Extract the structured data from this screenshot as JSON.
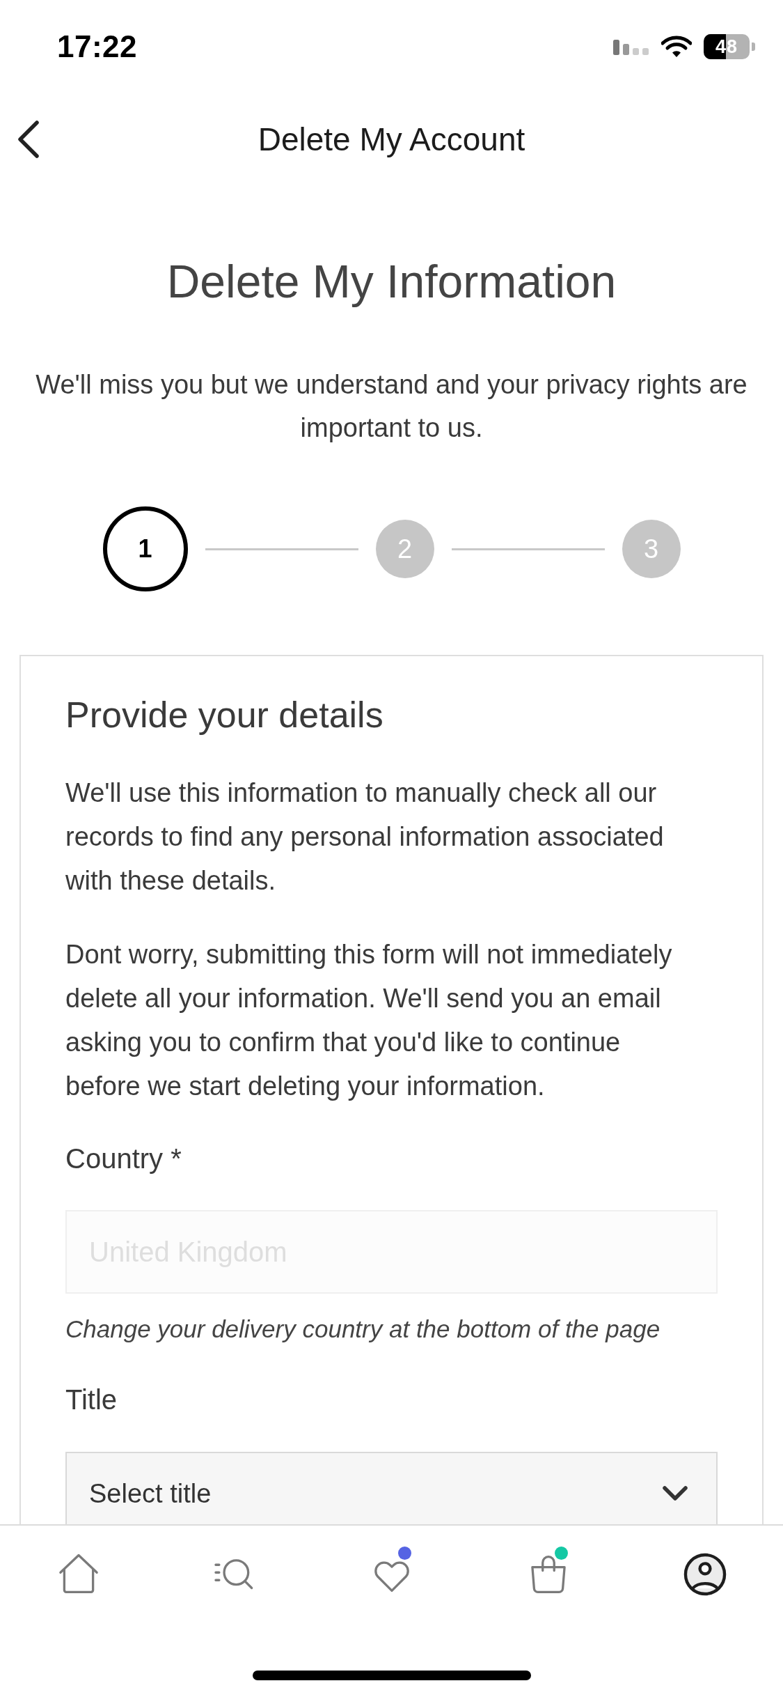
{
  "status_bar": {
    "time": "17:22",
    "battery": "48"
  },
  "header": {
    "title": "Delete My Account"
  },
  "intro": {
    "heading": "Delete My Information",
    "text": "We'll miss you but we understand and your privacy rights are important to us."
  },
  "stepper": [
    {
      "label": "1",
      "active": true
    },
    {
      "label": "2",
      "active": false
    },
    {
      "label": "3",
      "active": false
    }
  ],
  "form_card": {
    "heading": "Provide your details",
    "paragraphs": [
      "We'll use this information to manually check all our records to find any personal information associated with these details.",
      "Dont worry, submitting this form will not immediately delete all your information. We'll send you an email asking you to confirm that you'd like to continue before we start deleting your information."
    ],
    "fields": [
      {
        "kind": "text",
        "label": "Country *",
        "value": "United Kingdom",
        "disabled": true,
        "hint": "Change your delivery country at the bottom of the page"
      },
      {
        "kind": "select",
        "label": "Title",
        "placeholder": "Select title"
      }
    ]
  },
  "tab_bar": [
    {
      "kind": "home",
      "selected": false
    },
    {
      "kind": "search",
      "selected": false
    },
    {
      "kind": "wishlist",
      "selected": false,
      "color": "#5563e3"
    },
    {
      "kind": "bag",
      "selected": false,
      "color": "#14c8a4"
    },
    {
      "kind": "account",
      "selected": true
    }
  ]
}
